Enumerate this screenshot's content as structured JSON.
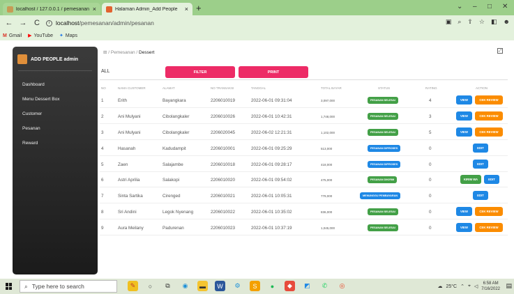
{
  "browser": {
    "tabs": [
      {
        "title": "localhost / 127.0.0.1 / pemesanan",
        "close": "×"
      },
      {
        "title": "Halaman Admin_Add People",
        "close": "×"
      }
    ],
    "new_tab": "+",
    "window_controls": {
      "minimize": "–",
      "maximize": "□",
      "close": "✕",
      "menu": "⌄"
    },
    "nav": {
      "back": "←",
      "forward": "→",
      "reload": "C"
    },
    "url_host": "localhost",
    "url_path": "/pemesanan/admin/pesanan",
    "bookmarks": [
      {
        "icon": "M",
        "label": "Gmail",
        "color": "#d93025"
      },
      {
        "icon": "▶",
        "label": "YouTube",
        "color": "#ff0000"
      },
      {
        "icon": "✦",
        "label": "Maps",
        "color": "#1a73e8"
      }
    ]
  },
  "sidebar": {
    "brand": "ADD PEOPLE admin",
    "items": [
      "Dashboard",
      "Menu Dessert Box",
      "Customer",
      "Pesanan",
      "Reward"
    ]
  },
  "breadcrumb": {
    "icon": "⊞",
    "sep": "/",
    "parent": "Pemesanan",
    "current": "Dessert"
  },
  "filter": {
    "all": "ALL",
    "filter_button": "FILTER",
    "print_button": "PRINT"
  },
  "table": {
    "headers": [
      "NO",
      "NAMA CUSTOMER",
      "ALAMAT",
      "NO TRANSAKSI",
      "TANGGAL",
      "TOTAL BAYAR",
      "STATUS",
      "RATING",
      "ACTION"
    ],
    "rows": [
      {
        "no": "1",
        "nama": "Erith",
        "alamat": "Bayangkara",
        "transaksi": "2206010019",
        "tanggal": "2022-06-01 09:31:04",
        "total": "3,097,000",
        "status": "PESANAN SELESAI",
        "status_color": "green",
        "rating": "4",
        "actions": [
          "VIEW",
          "CEK REVIEW"
        ]
      },
      {
        "no": "2",
        "nama": "Ani Mulyani",
        "alamat": "Cibolangkaler",
        "transaksi": "2206010026",
        "tanggal": "2022-06-01 10:42:31",
        "total": "1,748,000",
        "status": "PESANAN SELESAI",
        "status_color": "green",
        "rating": "3",
        "actions": [
          "VIEW",
          "CEK REVIEW"
        ]
      },
      {
        "no": "3",
        "nama": "Ani Mulyani",
        "alamat": "Cibolangkaler",
        "transaksi": "2206020045",
        "tanggal": "2022-06-02 12:21:31",
        "total": "1,102,000",
        "status": "PESANAN SELESAI",
        "status_color": "green",
        "rating": "5",
        "actions": [
          "VIEW",
          "CEK REVIEW"
        ]
      },
      {
        "no": "4",
        "nama": "Hasanah",
        "alamat": "Kadudampit",
        "transaksi": "2206010001",
        "tanggal": "2022-06-01 09:25:29",
        "total": "513,000",
        "status": "PESANAN DIPROSES",
        "status_color": "blue",
        "rating": "0",
        "actions": [
          "EDIT"
        ]
      },
      {
        "no": "5",
        "nama": "Zaen",
        "alamat": "Salajambe",
        "transaksi": "2206010018",
        "tanggal": "2022-06-01 09:28:17",
        "total": "418,000",
        "status": "PESANAN DIPROSES",
        "status_color": "blue",
        "rating": "0",
        "actions": [
          "EDIT"
        ]
      },
      {
        "no": "6",
        "nama": "Astri Aprilia",
        "alamat": "Salakopi",
        "transaksi": "2206010020",
        "tanggal": "2022-06-01 09:54:02",
        "total": "475,000",
        "status": "PESANAN DIKIRIM",
        "status_color": "green",
        "rating": "0",
        "actions": [
          "KIRIM WA",
          "EDIT"
        ]
      },
      {
        "no": "7",
        "nama": "Sinta Sartika",
        "alamat": "Cirenged",
        "transaksi": "2206010021",
        "tanggal": "2022-06-01 10:05:31",
        "total": "779,000",
        "status": "MENUNGGU PEMBAYARAN",
        "status_color": "blue",
        "rating": "0",
        "actions": [
          "EDIT"
        ]
      },
      {
        "no": "8",
        "nama": "Sri Andini",
        "alamat": "Legok Nyenang",
        "transaksi": "2206010022",
        "tanggal": "2022-06-01 10:35:02",
        "total": "836,000",
        "status": "PESANAN SELESAI",
        "status_color": "green",
        "rating": "0",
        "actions": [
          "VIEW",
          "CEK REVIEW"
        ]
      },
      {
        "no": "9",
        "nama": "Aura Meilany",
        "alamat": "Padurenan",
        "transaksi": "2206010023",
        "tanggal": "2022-06-01 10:37:19",
        "total": "1,045,000",
        "status": "PESANAN SELESAI",
        "status_color": "green",
        "rating": "0",
        "actions": [
          "VIEW",
          "CEK REVIEW"
        ]
      }
    ]
  },
  "taskbar": {
    "search_placeholder": "Type here to search",
    "weather": "25°C",
    "time": "6:58 AM",
    "date": "7/16/2022"
  },
  "colors": {
    "accent": "#ed2b66",
    "green": "#43a047",
    "blue": "#1e88e5",
    "orange": "#fb8c00",
    "chrome": "#9ccf8a"
  }
}
